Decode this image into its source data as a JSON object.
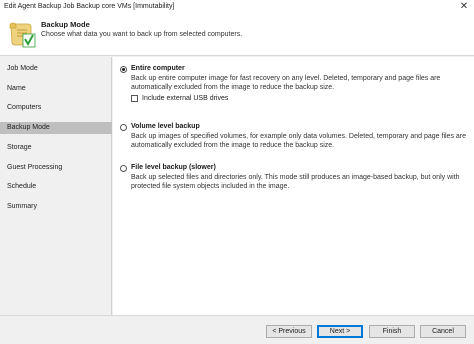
{
  "window": {
    "title": "Edit Agent Backup Job Backup core VMs [Immutability]",
    "close_glyph": "✕"
  },
  "header": {
    "title": "Backup Mode",
    "description": "Choose what data you want to back up from selected computers.",
    "icon": "wizard-scroll-checkmark-icon"
  },
  "sidebar": {
    "items": [
      {
        "label": "Job Mode"
      },
      {
        "label": "Name"
      },
      {
        "label": "Computers"
      },
      {
        "label": "Backup Mode",
        "active": true
      },
      {
        "label": "Storage"
      },
      {
        "label": "Guest Processing"
      },
      {
        "label": "Schedule"
      },
      {
        "label": "Summary"
      }
    ]
  },
  "options": [
    {
      "label": "Entire computer",
      "checked": true,
      "description": "Back up entire computer image for fast recovery on any level. Deleted, temporary and page files are automatically excluded from the image to reduce the backup size."
    },
    {
      "label": "Volume level backup",
      "checked": false,
      "description": "Back up images of specified volumes, for example only data volumes. Deleted, temporary and page files are automatically excluded from the image to reduce the backup size."
    },
    {
      "label": "File level backup (slower)",
      "checked": false,
      "description": "Back up selected files and directories only. This mode still produces an image-based backup, but only with protected file system objects included in the image."
    }
  ],
  "include_usb": {
    "label": "Include external USB drives",
    "checked": false
  },
  "buttons": {
    "previous": "< Previous",
    "next": "Next >",
    "finish": "Finish",
    "cancel": "Cancel"
  },
  "colors": {
    "active_sidebar": "#bfbfbf",
    "primary_border": "#0078d7",
    "icon_check": "#2e9e3a",
    "icon_scroll": "#e8c15a"
  }
}
